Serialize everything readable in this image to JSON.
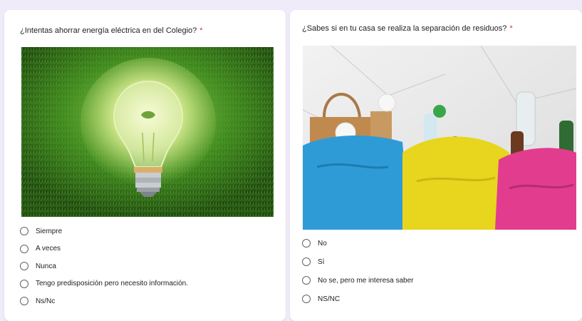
{
  "left_question": {
    "title": "¿Intentas ahorrar energía eléctrica en del Colegio?",
    "required_mark": "*",
    "options": [
      "Siempre",
      "A veces",
      "Nunca",
      "Tengo predisposición pero necesito información.",
      "Ns/Nc"
    ]
  },
  "right_question": {
    "title": "¿Sabes si en tu casa se realiza la separación de residuos?",
    "required_mark": "*",
    "options": [
      "No",
      "Sí",
      "No se, pero me interesa saber",
      "NS/NC"
    ]
  },
  "colors": {
    "required": "#d93025",
    "radio_border": "#5f6368",
    "page_background": "#f0ebf8"
  },
  "icons": [
    "lightbulb-grass-image",
    "recycling-bags-image",
    "radio-button-icon"
  ]
}
